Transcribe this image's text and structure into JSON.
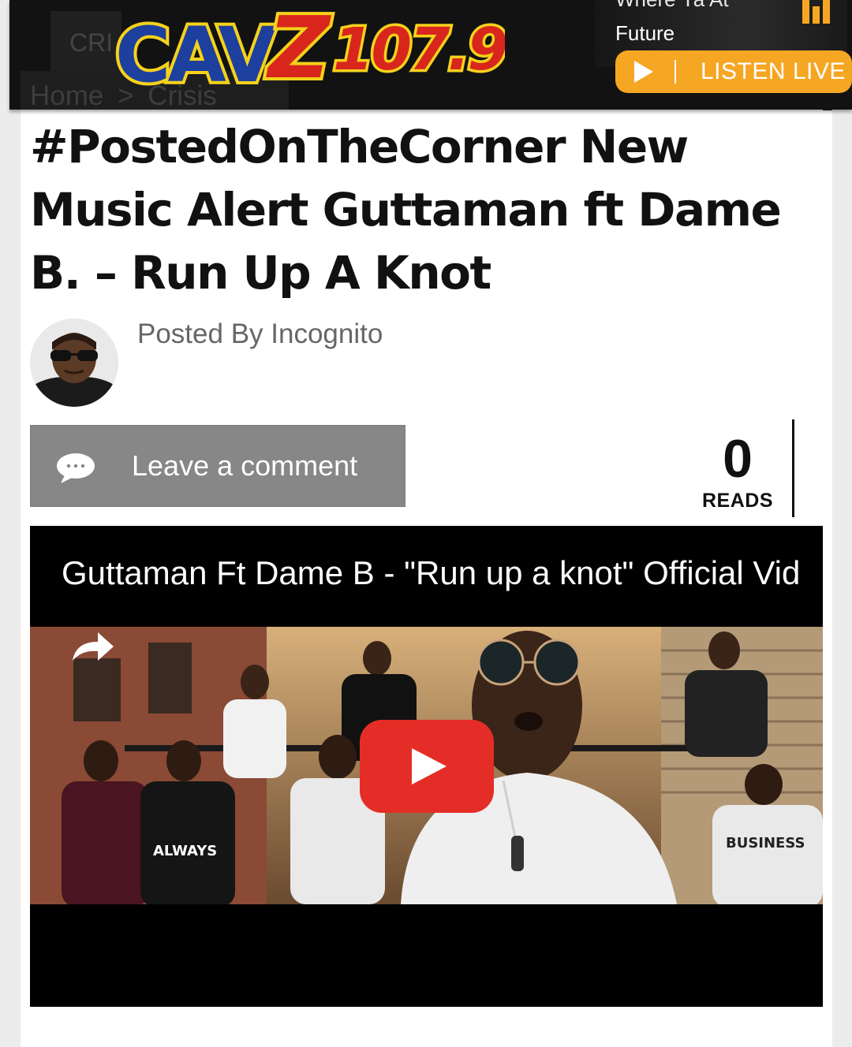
{
  "header": {
    "under_tab_text": "CRI",
    "breadcrumb": {
      "home": "Home",
      "separator": ">",
      "current": "Crisis"
    },
    "logo_text": "CAVZ 107.9",
    "now_playing": {
      "song": "Where Ya At",
      "artist": "Future"
    },
    "listen_live_label": "LISTEN LIVE"
  },
  "article": {
    "title": "#PostedOnTheCorner New Music Alert Guttaman ft Dame B. – Run Up A Knot",
    "posted_by": "Posted By Incognito",
    "comment_label": "Leave a comment",
    "reads_count": "0",
    "reads_label": "READS"
  },
  "video": {
    "title": "Guttaman Ft Dame B - \"Run up a knot\" Official Video",
    "shirt_text_top": "ALWAYS",
    "shirt_text_bottom": "BUSINESS"
  },
  "colors": {
    "accent": "#f5a623",
    "header_bg": "#121212",
    "comment_button": "#878787",
    "youtube_red": "#e52d27"
  },
  "icons": [
    "equalizer-icon",
    "play-icon",
    "comment-bubble-icon",
    "share-icon",
    "youtube-play-icon"
  ]
}
